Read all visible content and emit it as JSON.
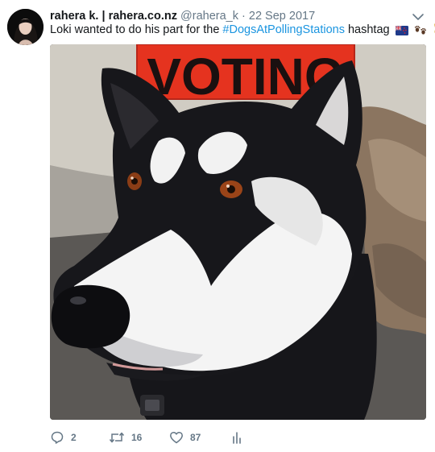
{
  "tweet": {
    "author_name": "rahera k. | rahera.co.nz",
    "handle": "@rahera_k",
    "separator": "·",
    "date": "22 Sep 2017",
    "text_prefix": "Loki wanted to do his part for the ",
    "hashtag": "#DogsAtPollingStations",
    "text_suffix": " hashtag",
    "emojis": [
      "new-zealand-flag",
      "paw-prints",
      "victory-hand"
    ],
    "media": {
      "sign_text": "VOTING",
      "subject": "dog"
    }
  },
  "actions": {
    "reply_count": "2",
    "retweet_count": "16",
    "like_count": "87"
  },
  "colors": {
    "text": "#14171a",
    "muted": "#657786",
    "link": "#1b95e0",
    "sign_red": "#e5331f"
  }
}
